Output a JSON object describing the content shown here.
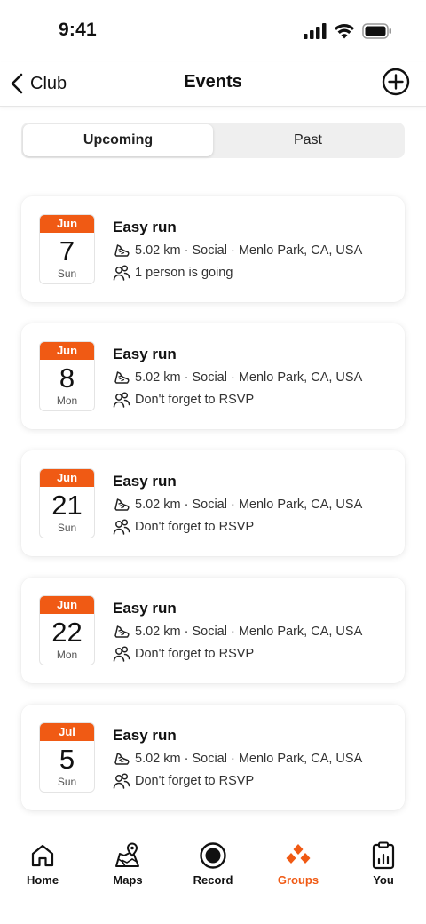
{
  "status_bar": {
    "time": "9:41"
  },
  "header": {
    "back_label": "Club",
    "title": "Events"
  },
  "segments": [
    {
      "label": "Upcoming",
      "active": true
    },
    {
      "label": "Past",
      "active": false
    }
  ],
  "events": [
    {
      "month": "Jun",
      "day": "7",
      "dow": "Sun",
      "title": "Easy run",
      "details": "5.02 km · Social · Menlo Park, CA, USA",
      "attendance": "1 person is going"
    },
    {
      "month": "Jun",
      "day": "8",
      "dow": "Mon",
      "title": "Easy run",
      "details": "5.02 km · Social · Menlo Park, CA, USA",
      "attendance": "Don't forget to RSVP"
    },
    {
      "month": "Jun",
      "day": "21",
      "dow": "Sun",
      "title": "Easy run",
      "details": "5.02 km · Social · Menlo Park, CA, USA",
      "attendance": "Don't forget to RSVP"
    },
    {
      "month": "Jun",
      "day": "22",
      "dow": "Mon",
      "title": "Easy run",
      "details": "5.02 km · Social · Menlo Park, CA, USA",
      "attendance": "Don't forget to RSVP"
    },
    {
      "month": "Jul",
      "day": "5",
      "dow": "Sun",
      "title": "Easy run",
      "details": "5.02 km · Social · Menlo Park, CA, USA",
      "attendance": "Don't forget to RSVP"
    }
  ],
  "tabs": [
    {
      "label": "Home",
      "icon": "home-icon",
      "active": false
    },
    {
      "label": "Maps",
      "icon": "maps-icon",
      "active": false
    },
    {
      "label": "Record",
      "icon": "record-icon",
      "active": false
    },
    {
      "label": "Groups",
      "icon": "groups-icon",
      "active": true
    },
    {
      "label": "You",
      "icon": "you-icon",
      "active": false
    }
  ],
  "colors": {
    "accent": "#f05a14",
    "text": "#111111",
    "segment_bg": "#efefef"
  }
}
